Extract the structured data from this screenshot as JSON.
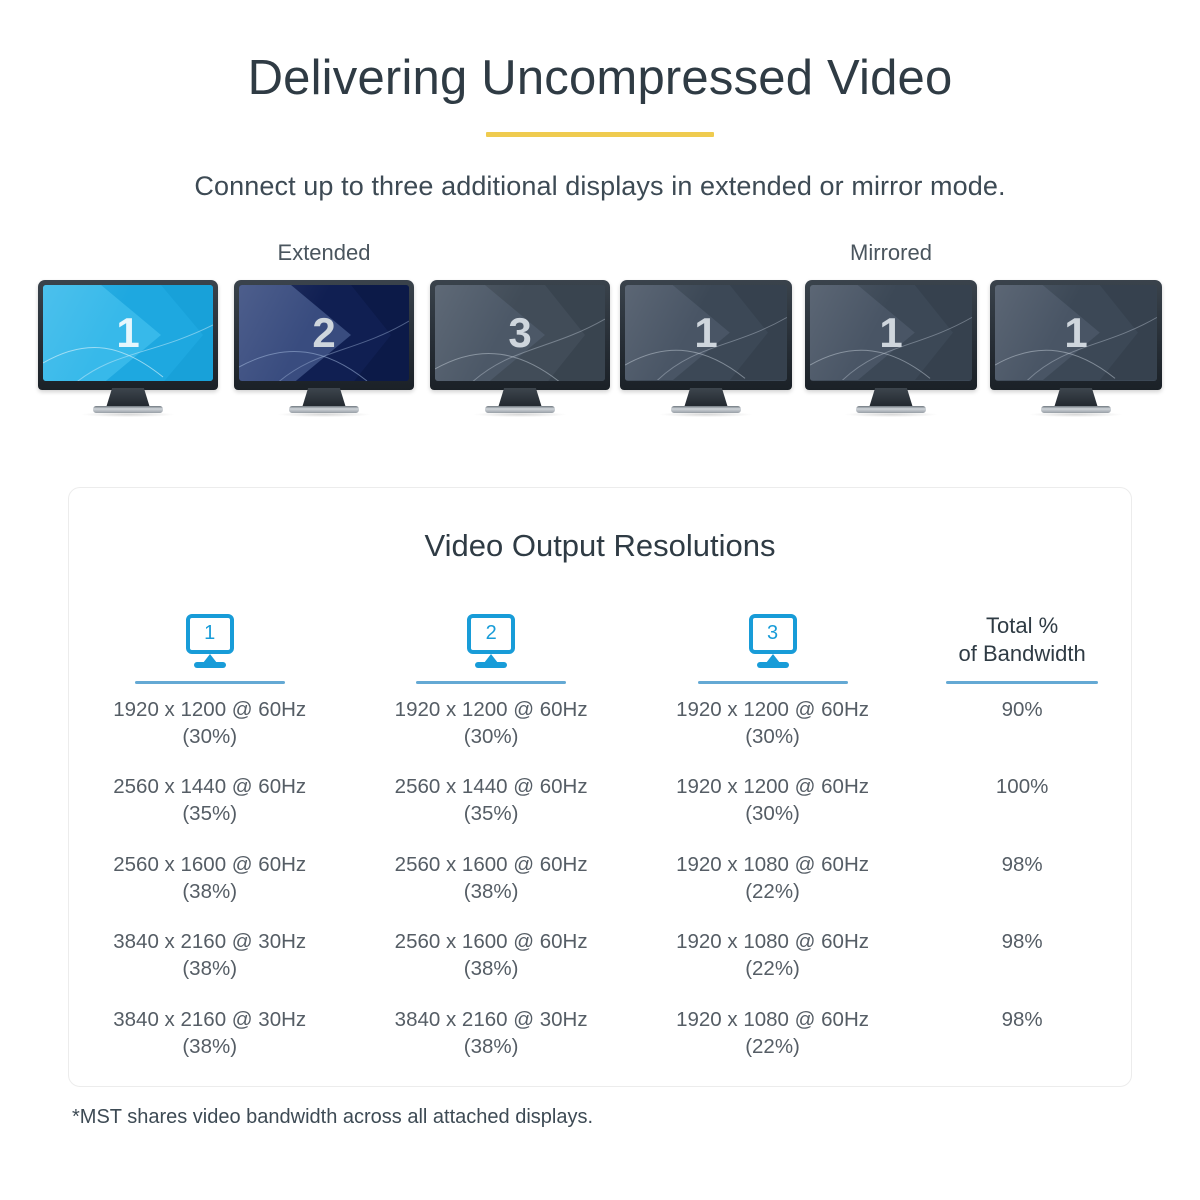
{
  "header": {
    "title": "Delivering Uncompressed Video",
    "subtitle": "Connect up to three additional displays in extended or mirror mode.",
    "accent_color": "#efcb4f"
  },
  "display_modes": {
    "extended": {
      "label": "Extended",
      "monitors": [
        {
          "number": "1",
          "screen_color": "#1ea8e0"
        },
        {
          "number": "2",
          "screen_color": "#101f52"
        },
        {
          "number": "3",
          "screen_color": "#414c58"
        }
      ]
    },
    "mirrored": {
      "label": "Mirrored",
      "monitors": [
        {
          "number": "1",
          "screen_color": "#3c4856"
        },
        {
          "number": "1",
          "screen_color": "#3c4856"
        },
        {
          "number": "1",
          "screen_color": "#3c4856"
        }
      ]
    }
  },
  "card": {
    "title": "Video Output Resolutions",
    "accent_color": "#189cd8",
    "rule_color": "#64a9d4",
    "columns": [
      {
        "icon": "monitor-1-icon",
        "number": "1",
        "type": "monitor"
      },
      {
        "icon": "monitor-2-icon",
        "number": "2",
        "type": "monitor"
      },
      {
        "icon": "monitor-3-icon",
        "number": "3",
        "type": "monitor"
      },
      {
        "label_line1": "Total %",
        "label_line2": "of Bandwidth",
        "type": "text"
      }
    ],
    "rows": [
      {
        "display1": "1920 x 1200 @ 60Hz",
        "display1_pct": "(30%)",
        "display2": "1920 x 1200 @ 60Hz",
        "display2_pct": "(30%)",
        "display3": "1920 x 1200 @ 60Hz",
        "display3_pct": "(30%)",
        "total": "90%"
      },
      {
        "display1": "2560 x 1440 @ 60Hz",
        "display1_pct": "(35%)",
        "display2": "2560 x 1440 @ 60Hz",
        "display2_pct": "(35%)",
        "display3": "1920 x 1200 @ 60Hz",
        "display3_pct": "(30%)",
        "total": "100%"
      },
      {
        "display1": "2560 x 1600 @ 60Hz",
        "display1_pct": "(38%)",
        "display2": "2560 x 1600 @ 60Hz",
        "display2_pct": "(38%)",
        "display3": "1920 x 1080 @ 60Hz",
        "display3_pct": "(22%)",
        "total": "98%"
      },
      {
        "display1": "3840 x 2160 @ 30Hz",
        "display1_pct": "(38%)",
        "display2": "2560 x 1600 @ 60Hz",
        "display2_pct": "(38%)",
        "display3": "1920 x 1080 @ 60Hz",
        "display3_pct": "(22%)",
        "total": "98%"
      },
      {
        "display1": "3840 x 2160 @ 30Hz",
        "display1_pct": "(38%)",
        "display2": "3840 x 2160 @ 30Hz",
        "display2_pct": "(38%)",
        "display3": "1920 x 1080 @ 60Hz",
        "display3_pct": "(22%)",
        "total": "98%"
      }
    ]
  },
  "footnote": "*MST shares video bandwidth across all attached displays."
}
